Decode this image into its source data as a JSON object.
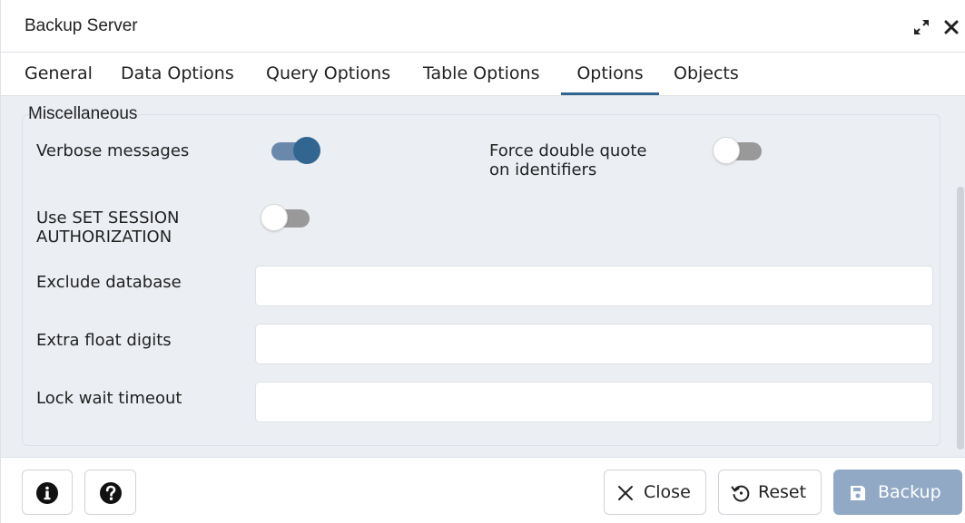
{
  "window": {
    "title": "Backup Server"
  },
  "tabs": [
    {
      "label": "General"
    },
    {
      "label": "Data Options"
    },
    {
      "label": "Query Options"
    },
    {
      "label": "Table Options"
    },
    {
      "label": "Options",
      "active": true
    },
    {
      "label": "Objects"
    }
  ],
  "section": {
    "legend": "Miscellaneous",
    "verbose_messages": {
      "label": "Verbose messages",
      "enabled": true
    },
    "force_double_quote": {
      "label_line1": "Force double quote",
      "label_line2": "on identifiers",
      "enabled": false
    },
    "set_session_authorization": {
      "label_line1": "Use SET SESSION",
      "label_line2": "AUTHORIZATION",
      "enabled": false
    },
    "exclude_database": {
      "label": "Exclude database",
      "value": ""
    },
    "extra_float_digits": {
      "label": "Extra float digits",
      "value": ""
    },
    "lock_wait_timeout": {
      "label": "Lock wait timeout",
      "value": ""
    }
  },
  "footer": {
    "info_icon": "info-circle",
    "help_icon": "question-circle",
    "close_label": "Close",
    "reset_label": "Reset",
    "backup_label": "Backup"
  },
  "colors": {
    "accent": "#326690",
    "toggle_on_track": "#6a88ab",
    "toggle_off_track": "#999999",
    "panel_bg": "#ebeef3",
    "primary_button_disabled": "#92a9c5"
  }
}
